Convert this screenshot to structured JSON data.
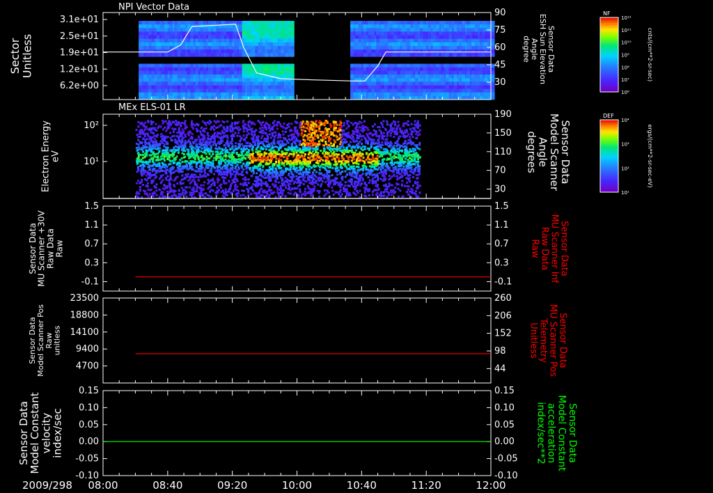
{
  "colors": {
    "background": "#000000",
    "axis": "#ffffff",
    "red_trace": "#ff0000",
    "green_trace": "#00ff00",
    "white_trace": "#ffffff"
  },
  "bottom_axis": {
    "date_label": "2009/298",
    "ticks": [
      "08:00",
      "08:40",
      "09:20",
      "10:00",
      "10:40",
      "11:20",
      "12:00"
    ]
  },
  "chart_data": [
    {
      "id": "npi",
      "type": "heatmap",
      "title": "NPI Vector Data",
      "ylabel_lines": [
        "Sector",
        "Unitless"
      ],
      "ytick_labels": [
        "3.1e+01",
        "2.5e+01",
        "1.9e+01",
        "1.2e+01",
        "6.2e+00"
      ],
      "right_ylabel_lines": [
        "Sensor Data",
        "ESH Sun Elevation",
        "Angle",
        "degree"
      ],
      "right_ylim": [
        15,
        90
      ],
      "right_ticks": [
        90,
        75,
        60,
        45,
        30
      ],
      "right_line": {
        "name": "",
        "x": [
          "08:00",
          "08:40",
          "08:48",
          "08:55",
          "09:10",
          "09:22",
          "09:27",
          "09:35",
          "09:50",
          "10:10",
          "10:35",
          "10:42",
          "10:50",
          "10:55",
          "12:00"
        ],
        "y": [
          56,
          56,
          62,
          78,
          79,
          80,
          60,
          38,
          33,
          32,
          31,
          31,
          44,
          56,
          56
        ]
      },
      "colorbar": {
        "label": "NF",
        "units": "cnts/(cm**2-sr-sec)",
        "tick_labels": [
          "10¹²",
          "10¹¹",
          "10¹⁰",
          "10⁹",
          "10⁸",
          "10⁷",
          "10⁶"
        ]
      }
    },
    {
      "id": "els",
      "type": "heatmap",
      "title": "MEx ELS-01 LR",
      "ylabel_lines": [
        "Electron Energy",
        "eV"
      ],
      "ytick_labels": [
        "10²",
        "10¹"
      ],
      "right_ylabel_lines": [
        "Sensor Data",
        "Model Scanner",
        "Angle",
        "degrees"
      ],
      "right_ylim": [
        10,
        190
      ],
      "right_ticks": [
        190,
        150,
        110,
        70,
        30
      ],
      "right_line": {
        "name": "",
        "x": [
          "08:00",
          "12:00"
        ],
        "y": [
          10,
          10
        ]
      },
      "colorbar": {
        "label": "DEF",
        "units": "ergs/(cm**2-sr-sec-eV)",
        "tick_labels": [
          "10⁴",
          "10³",
          "10²",
          "10¹"
        ]
      }
    },
    {
      "id": "mu_raw",
      "type": "line",
      "ylabel_lines": [
        "Sensor Data",
        "MU Scanner +30V",
        "Raw Data",
        "Raw"
      ],
      "ylim": [
        -0.3,
        1.5
      ],
      "yticks": [
        1.5,
        1.1,
        0.7,
        0.3,
        -0.1
      ],
      "right_ylabel_lines": [
        "Sensor Data",
        "MU Scanner Inf",
        "Raw Data",
        "Raw"
      ],
      "right_ylim": [
        -0.3,
        1.5
      ],
      "right_ticks": [
        1.5,
        1.1,
        0.7,
        0.3,
        -0.1
      ],
      "series": [
        {
          "name": "",
          "color": "#ff0000",
          "x": [
            "08:20",
            "12:00"
          ],
          "y": [
            0.0,
            0.0
          ]
        }
      ]
    },
    {
      "id": "mu_pos",
      "type": "line",
      "ylabel_lines": [
        "Sensor Data",
        "Model Scanner Pos",
        "Raw",
        "unitless"
      ],
      "ylim": [
        0,
        23500
      ],
      "yticks": [
        23500,
        18800,
        14100,
        9400,
        4700
      ],
      "right_ylabel_lines": [
        "Sensor Data",
        "MU Scanner Pos",
        "Telemetry",
        "Unitless"
      ],
      "right_ylim": [
        0,
        260
      ],
      "right_ticks": [
        260,
        206,
        152,
        98,
        44
      ],
      "series": [
        {
          "name": "",
          "color": "#ff0000",
          "x": [
            "08:20",
            "12:00"
          ],
          "y": [
            8100,
            8100
          ]
        }
      ]
    },
    {
      "id": "const",
      "type": "line",
      "ylabel_lines": [
        "Sensor Data",
        "Model Constant",
        "velocity",
        "index/sec"
      ],
      "ylim": [
        -0.1,
        0.15
      ],
      "yticks": [
        0.15,
        0.1,
        0.05,
        0.0,
        -0.05,
        -0.1
      ],
      "ytick_labels": [
        "0.15",
        "0.10",
        "0.05",
        "0.00",
        "-0.05",
        "-0.10"
      ],
      "right_ylabel_lines": [
        "Sensor Data",
        "Model Constant",
        "acceleration",
        "index/sec**2"
      ],
      "right_ylim": [
        -0.1,
        0.15
      ],
      "right_ticks": [
        0.15,
        0.1,
        0.05,
        0.0,
        -0.05,
        -0.1
      ],
      "right_tick_labels": [
        "0.15",
        "0.10",
        "0.05",
        "0.00",
        "-0.05",
        "-0.10"
      ],
      "series": [
        {
          "name": "",
          "color": "#00ff00",
          "x": [
            "08:00",
            "12:00"
          ],
          "y": [
            0.0,
            0.0
          ]
        }
      ]
    }
  ]
}
